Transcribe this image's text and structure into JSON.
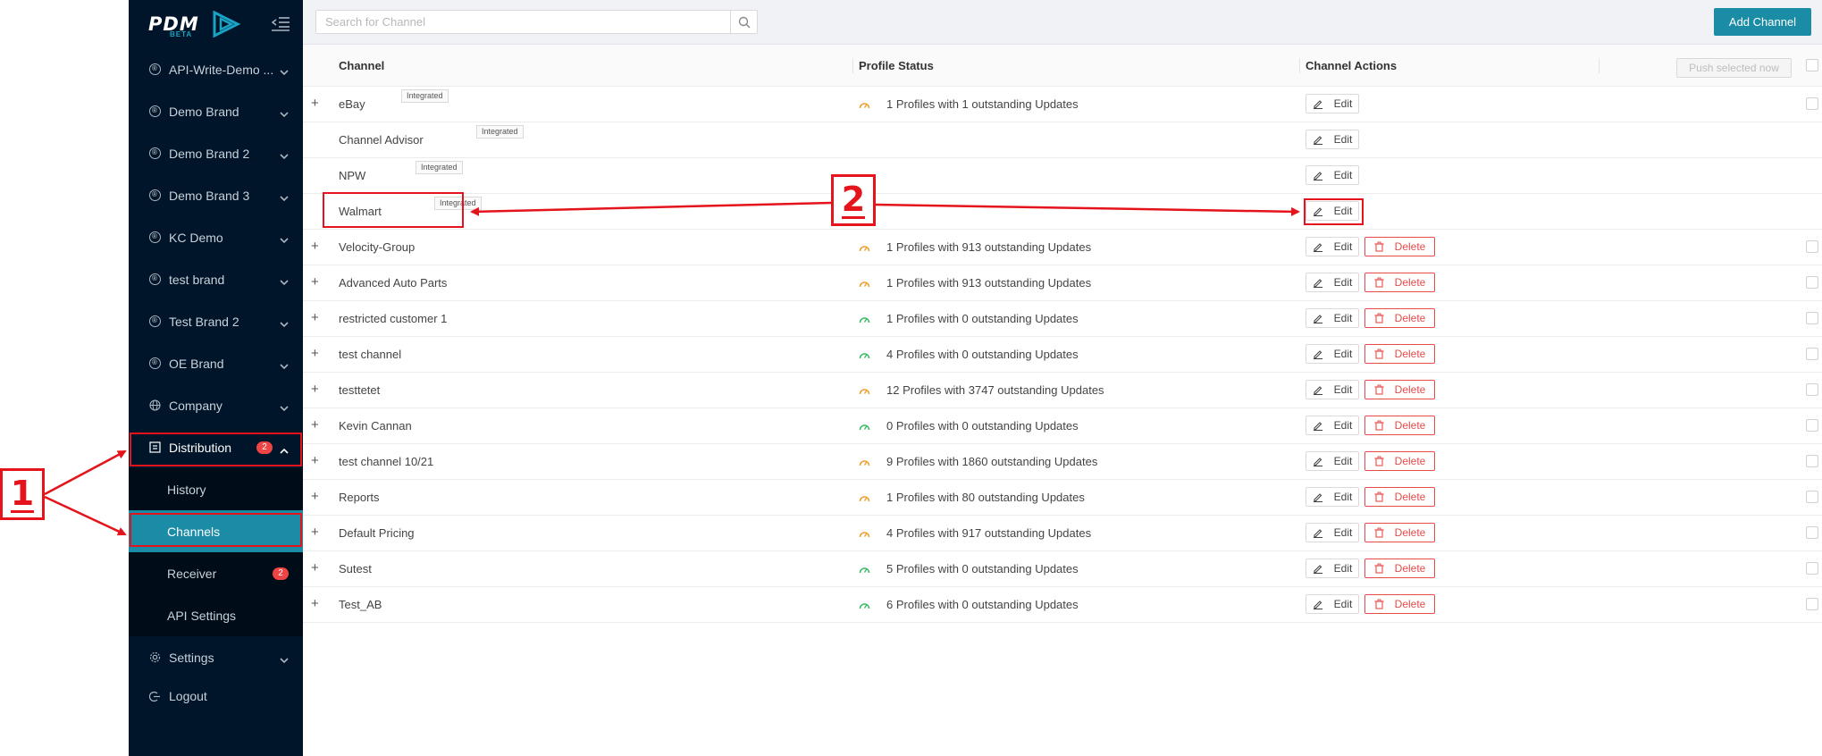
{
  "brand": {
    "logo": "PDM",
    "beta": "BETA",
    "accent": "#1a8ca6"
  },
  "search": {
    "placeholder": "Search for Channel"
  },
  "actions": {
    "add_channel": "Add Channel",
    "push_selected": "Push selected now"
  },
  "sidebar": {
    "items": [
      {
        "label": "API-Write-Demo ...",
        "icon": "registered-icon"
      },
      {
        "label": "Demo Brand",
        "icon": "registered-icon"
      },
      {
        "label": "Demo Brand 2",
        "icon": "registered-icon"
      },
      {
        "label": "Demo Brand 3",
        "icon": "registered-icon"
      },
      {
        "label": "KC Demo",
        "icon": "registered-icon"
      },
      {
        "label": "test brand",
        "icon": "registered-icon"
      },
      {
        "label": "Test Brand 2",
        "icon": "registered-icon"
      },
      {
        "label": "OE Brand",
        "icon": "registered-icon"
      },
      {
        "label": "Company",
        "icon": "globe-icon"
      }
    ],
    "distribution": {
      "label": "Distribution",
      "badge": "2"
    },
    "submenu": [
      {
        "label": "History"
      },
      {
        "label": "Channels",
        "active": true
      },
      {
        "label": "Receiver",
        "badge": "2"
      },
      {
        "label": "API Settings"
      }
    ],
    "settings": {
      "label": "Settings"
    },
    "logout": {
      "label": "Logout"
    }
  },
  "table": {
    "headers": {
      "channel": "Channel",
      "status": "Profile Status",
      "actions": "Channel Actions"
    },
    "edit_label": "Edit",
    "delete_label": "Delete",
    "integrated_label": "Integrated",
    "rows": [
      {
        "name": "eBay",
        "expandable": true,
        "integrated": true,
        "status": "1 Profiles with 1 outstanding Updates",
        "status_level": "warning",
        "deletable": false,
        "checkbox": true
      },
      {
        "name": "Channel Advisor",
        "expandable": false,
        "integrated": true,
        "status": "",
        "deletable": false,
        "checkbox": false
      },
      {
        "name": "NPW",
        "expandable": false,
        "integrated": true,
        "status": "",
        "deletable": false,
        "checkbox": false
      },
      {
        "name": "Walmart",
        "expandable": false,
        "integrated": true,
        "status": "",
        "deletable": false,
        "checkbox": false
      },
      {
        "name": "Velocity-Group",
        "expandable": true,
        "integrated": false,
        "status": "1 Profiles with 913 outstanding Updates",
        "status_level": "warning",
        "deletable": true,
        "checkbox": true
      },
      {
        "name": "Advanced Auto Parts",
        "expandable": true,
        "integrated": false,
        "status": "1 Profiles with 913 outstanding Updates",
        "status_level": "warning",
        "deletable": true,
        "checkbox": true
      },
      {
        "name": "restricted customer 1",
        "expandable": true,
        "integrated": false,
        "status": "1 Profiles with 0 outstanding Updates",
        "status_level": "ok",
        "deletable": true,
        "checkbox": true
      },
      {
        "name": "test channel",
        "expandable": true,
        "integrated": false,
        "status": "4 Profiles with 0 outstanding Updates",
        "status_level": "ok",
        "deletable": true,
        "checkbox": true
      },
      {
        "name": "testtetet",
        "expandable": true,
        "integrated": false,
        "status": "12 Profiles with 3747 outstanding Updates",
        "status_level": "warning",
        "deletable": true,
        "checkbox": true
      },
      {
        "name": "Kevin Cannan",
        "expandable": true,
        "integrated": false,
        "status": "0 Profiles with 0 outstanding Updates",
        "status_level": "ok",
        "deletable": true,
        "checkbox": true
      },
      {
        "name": "test channel 10/21",
        "expandable": true,
        "integrated": false,
        "status": "9 Profiles with 1860 outstanding Updates",
        "status_level": "warning",
        "deletable": true,
        "checkbox": true
      },
      {
        "name": "Reports",
        "expandable": true,
        "integrated": false,
        "status": "1 Profiles with 80 outstanding Updates",
        "status_level": "warning",
        "deletable": true,
        "checkbox": true
      },
      {
        "name": "Default Pricing",
        "expandable": true,
        "integrated": false,
        "status": "4 Profiles with 917 outstanding Updates",
        "status_level": "warning",
        "deletable": true,
        "checkbox": true
      },
      {
        "name": "Sutest",
        "expandable": true,
        "integrated": false,
        "status": "5 Profiles with 0 outstanding Updates",
        "status_level": "ok",
        "deletable": true,
        "checkbox": true
      },
      {
        "name": "Test_AB",
        "expandable": true,
        "integrated": false,
        "status": "6 Profiles with 0 outstanding Updates",
        "status_level": "ok",
        "deletable": true,
        "checkbox": true
      }
    ]
  },
  "annotations": {
    "callout_1": "1",
    "callout_2": "2",
    "color": "#e5131b"
  },
  "colors": {
    "sidebar_bg": "#001529",
    "warning": "#f0a030",
    "ok": "#3dbb6a",
    "danger": "#e84a4a"
  }
}
